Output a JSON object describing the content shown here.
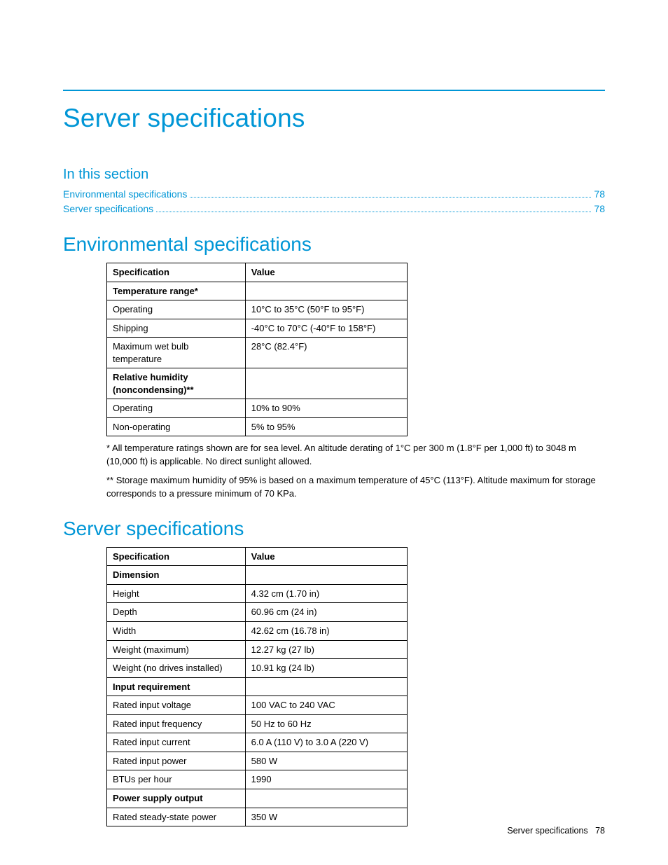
{
  "pageTitle": "Server specifications",
  "sectionHeading": "In this section",
  "toc": [
    {
      "label": "Environmental specifications",
      "page": "78"
    },
    {
      "label": "Server specifications",
      "page": "78"
    }
  ],
  "envSection": {
    "title": "Environmental specifications",
    "headers": {
      "spec": "Specification",
      "value": "Value"
    },
    "rows": [
      {
        "spec": "Temperature range*",
        "value": "",
        "bold": true
      },
      {
        "spec": "Operating",
        "value": "10°C  to 35°C (50°F to 95°F)"
      },
      {
        "spec": "Shipping",
        "value": "-40°C  to 70°C (-40°F to 158°F)"
      },
      {
        "spec": "Maximum wet bulb temperature",
        "value": "28°C (82.4°F)"
      },
      {
        "spec": "Relative humidity (noncondensing)**",
        "value": "",
        "bold": true
      },
      {
        "spec": "Operating",
        "value": "10% to 90%"
      },
      {
        "spec": "Non-operating",
        "value": "5% to 95%"
      }
    ],
    "footnotes": [
      "* All temperature ratings shown are for sea level. An altitude derating of 1°C per 300 m (1.8°F per 1,000 ft) to 3048 m (10,000 ft) is applicable. No direct sunlight allowed.",
      "** Storage maximum humidity of 95% is based on a maximum temperature of 45°C (113°F). Altitude maximum for storage corresponds to a pressure minimum of 70 KPa."
    ]
  },
  "serverSection": {
    "title": "Server specifications",
    "headers": {
      "spec": "Specification",
      "value": "Value"
    },
    "rows": [
      {
        "spec": "Dimension",
        "value": "",
        "bold": true
      },
      {
        "spec": "Height",
        "value": "4.32 cm (1.70 in)"
      },
      {
        "spec": "Depth",
        "value": "60.96 cm (24 in)"
      },
      {
        "spec": "Width",
        "value": "42.62 cm (16.78 in)"
      },
      {
        "spec": "Weight (maximum)",
        "value": "12.27 kg (27 lb)"
      },
      {
        "spec": "Weight (no drives installed)",
        "value": "10.91 kg (24 lb)"
      },
      {
        "spec": "Input requirement",
        "value": "",
        "bold": true
      },
      {
        "spec": "Rated input voltage",
        "value": "100 VAC to 240 VAC"
      },
      {
        "spec": "Rated input frequency",
        "value": "50 Hz to 60 Hz"
      },
      {
        "spec": "Rated input current",
        "value": "6.0 A (110 V) to 3.0 A (220 V)"
      },
      {
        "spec": "Rated input power",
        "value": "580 W"
      },
      {
        "spec": "BTUs per hour",
        "value": "1990"
      },
      {
        "spec": "Power supply output",
        "value": "",
        "bold": true
      },
      {
        "spec": "Rated steady-state power",
        "value": "350 W"
      }
    ]
  },
  "footer": {
    "label": "Server specifications",
    "page": "78"
  }
}
